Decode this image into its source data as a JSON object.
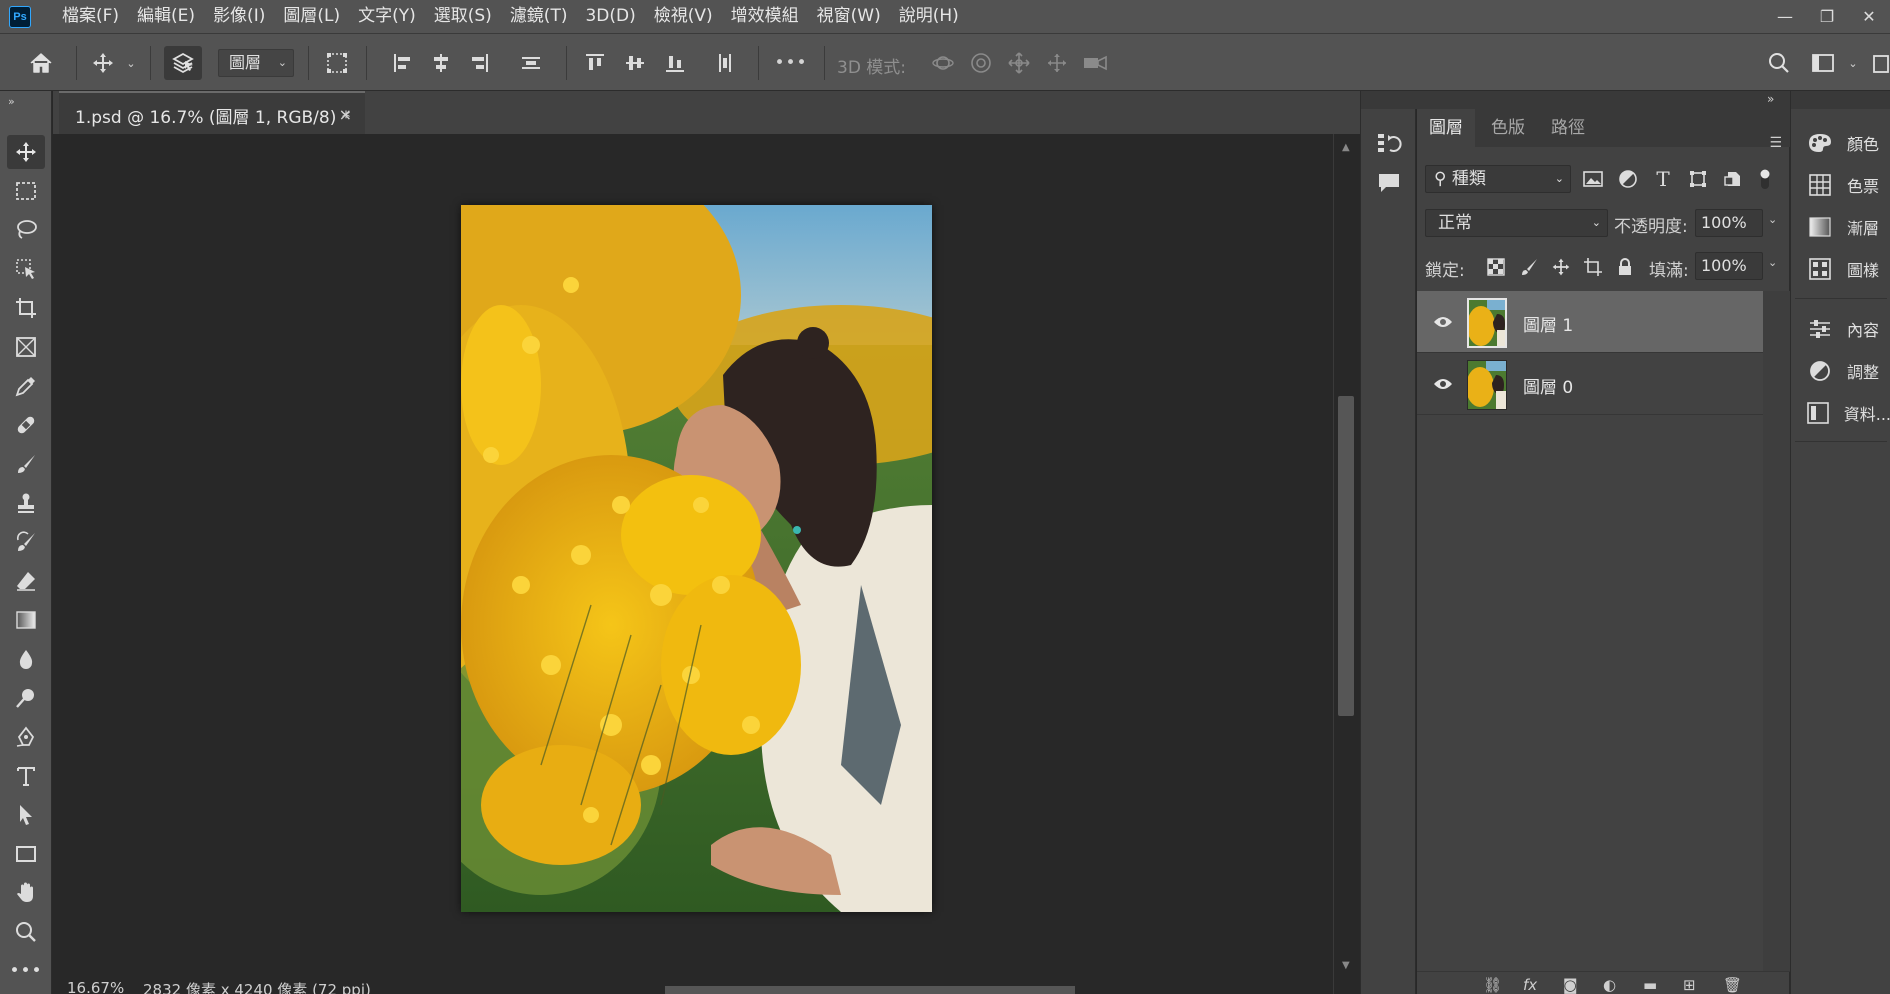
{
  "app": {
    "logo_text": "Ps"
  },
  "menu": [
    "檔案(F)",
    "編輯(E)",
    "影像(I)",
    "圖層(L)",
    "文字(Y)",
    "選取(S)",
    "濾鏡(T)",
    "3D(D)",
    "檢視(V)",
    "增效模組",
    "視窗(W)",
    "說明(H)"
  ],
  "window_controls": {
    "minimize": "—",
    "restore": "❐",
    "close": "✕"
  },
  "options_bar": {
    "auto_select_target": "圖層",
    "mode3d_label": "3D 模式:",
    "more_label": "•••"
  },
  "document": {
    "tab_label": "1.psd @ 16.7% (圖層 1, RGB/8) *",
    "close_label": "×"
  },
  "status": {
    "zoom": "16.67%",
    "doc_info": "2832 像素 x 4240 像素 (72 ppi)"
  },
  "layers_panel": {
    "tabs": [
      "圖層",
      "色版",
      "路徑"
    ],
    "active_tab": 0,
    "kind_filter": "種類",
    "blend_mode": "正常",
    "opacity_label": "不透明度:",
    "opacity_value": "100%",
    "lock_label": "鎖定:",
    "fill_label": "填滿:",
    "fill_value": "100%",
    "layers": [
      {
        "name": "圖層 1",
        "selected": true,
        "visible": true
      },
      {
        "name": "圖層 0",
        "selected": false,
        "visible": true
      }
    ],
    "footer_fx": "fx"
  },
  "right_panel": {
    "items": [
      {
        "label": "顏色",
        "icon": "palette-icon"
      },
      {
        "label": "色票",
        "icon": "swatches-grid-icon"
      },
      {
        "label": "漸層",
        "icon": "gradient-icon"
      },
      {
        "label": "圖樣",
        "icon": "pattern-icon"
      },
      {
        "label": "內容",
        "icon": "properties-sliders-icon"
      },
      {
        "label": "調整",
        "icon": "adjustments-icon"
      },
      {
        "label": "資料...",
        "icon": "libraries-icon"
      }
    ]
  },
  "colors": {
    "chrome": "#535353",
    "panel": "#424242",
    "canvas_bg": "#282828",
    "selected_layer": "#666666",
    "ps_blue": "#31a8ff"
  }
}
